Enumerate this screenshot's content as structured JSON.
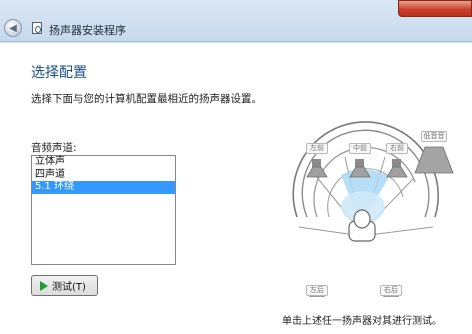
{
  "titlebar": {
    "title": "扬声器安装程序"
  },
  "page": {
    "heading": "选择配置",
    "description": "选择下面与您的计算机配置最相近的扬声器设置。",
    "channels_label": "音频声道:",
    "channels": [
      {
        "label": "立体声",
        "selected": false
      },
      {
        "label": "四声道",
        "selected": false
      },
      {
        "label": "5.1 环绕",
        "selected": true
      }
    ],
    "test_button": "测试(T)",
    "footer_hint": "单击上述任一扬声器对其进行测试。"
  },
  "speakers": {
    "front_left": "左前",
    "center": "中前",
    "front_right": "右前",
    "subwoofer": "低音音",
    "rear_left": "左后",
    "rear_right": "右后"
  },
  "colors": {
    "selection": "#3399ff",
    "heading": "#1a4f8e",
    "highlight": "#a9d8f5",
    "play": "#1f9e2f"
  }
}
